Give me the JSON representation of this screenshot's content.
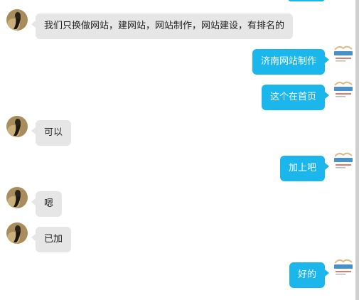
{
  "colors": {
    "sent_bubble": "#1ab6ec",
    "received_bubble": "#e6e6e6",
    "background": "#ffffff"
  },
  "messages": [
    {
      "side": "left",
      "text": "我们只换做网站，建网站，网站制作，网站建设，有排名的"
    },
    {
      "side": "right",
      "text": "济南网站制作"
    },
    {
      "side": "right",
      "text": "这个在首页"
    },
    {
      "side": "left",
      "text": "可以"
    },
    {
      "side": "right",
      "text": "加上吧"
    },
    {
      "side": "left",
      "text": "嗯"
    },
    {
      "side": "left",
      "text": "已加"
    },
    {
      "side": "right",
      "text": "好的"
    }
  ]
}
